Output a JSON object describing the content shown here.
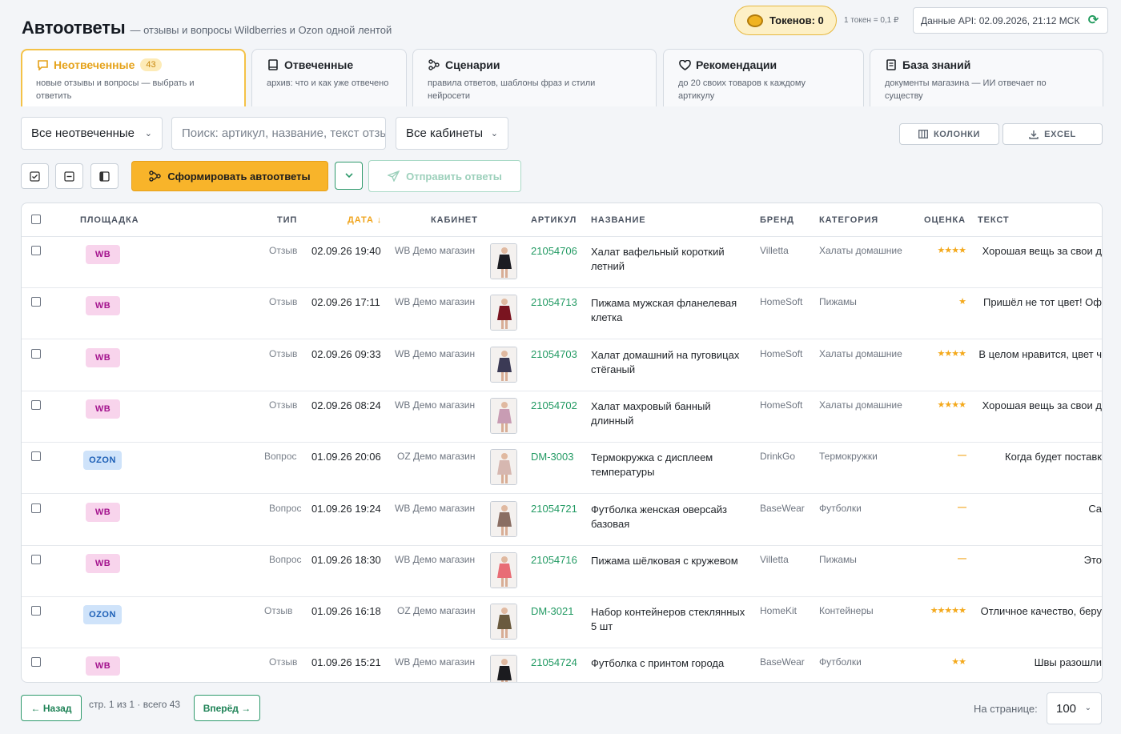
{
  "header": {
    "title": "Автоответы",
    "subtitle": "— отзывы и вопросы Wildberries и Ozon одной лентой",
    "tokens_label": "Токенов: 0",
    "rate": "1 токен = 0,1 ₽",
    "api_status": "Данные API: 02.09.2026, 21:12 МСК"
  },
  "tabs": [
    {
      "label": "Неотвеченные",
      "badge": "43",
      "desc": "новые отзывы и вопросы — выбрать и ответить",
      "icon": "chat-icon",
      "active": true
    },
    {
      "label": "Отвеченные",
      "desc": "архив: что и как уже отвечено",
      "icon": "archive-icon"
    },
    {
      "label": "Сценарии",
      "desc": "правила ответов, шаблоны фраз и стили нейросети",
      "icon": "flow-icon"
    },
    {
      "label": "Рекомендации",
      "desc": "до 20 своих товаров к каждому артикулу",
      "icon": "heart-icon"
    },
    {
      "label": "База знаний",
      "desc": "документы магазина — ИИ отвечает по существу",
      "icon": "book-icon"
    }
  ],
  "filters": {
    "status": "Все неотвеченные",
    "search_placeholder": "Поиск: артикул, название, текст отзыва",
    "cabinet": "Все кабинеты",
    "columns_label": "КОЛОНКИ",
    "excel_label": "EXCEL"
  },
  "actions": {
    "generate_label": "Сформировать автоответы",
    "send_label": "Отправить ответы"
  },
  "table": {
    "headers": {
      "platform": "ПЛОЩАДКА",
      "type": "ТИП",
      "date": "ДАТА ↓",
      "cabinet": "КАБИНЕТ",
      "article": "АРТИКУЛ",
      "name": "НАЗВАНИЕ",
      "brand": "БРЕНД",
      "category": "КАТЕГОРИЯ",
      "rating": "ОЦЕНКА",
      "text": "ТЕКСТ"
    },
    "rows": [
      {
        "platform": "WB",
        "type": "Отзыв",
        "date": "02.09.26 19:40",
        "cabinet": "WB Демо магазин",
        "article": "21054706",
        "name": "Халат вафельный короткий летний",
        "brand": "Villetta",
        "category": "Халаты домашние",
        "rating": "★★★★",
        "text": "Хорошая вещь за свои д"
      },
      {
        "platform": "WB",
        "type": "Отзыв",
        "date": "02.09.26 17:11",
        "cabinet": "WB Демо магазин",
        "article": "21054713",
        "name": "Пижама мужская фланелевая клетка",
        "brand": "HomeSoft",
        "category": "Пижамы",
        "rating": "★",
        "text": "Пришёл не тот цвет! Оф"
      },
      {
        "platform": "WB",
        "type": "Отзыв",
        "date": "02.09.26 09:33",
        "cabinet": "WB Демо магазин",
        "article": "21054703",
        "name": "Халат домашний на пуговицах стёганый",
        "brand": "HomeSoft",
        "category": "Халаты домашние",
        "rating": "★★★★",
        "text": "В целом нравится, цвет ч"
      },
      {
        "platform": "WB",
        "type": "Отзыв",
        "date": "02.09.26 08:24",
        "cabinet": "WB Демо магазин",
        "article": "21054702",
        "name": "Халат махровый банный длинный",
        "brand": "HomeSoft",
        "category": "Халаты домашние",
        "rating": "★★★★",
        "text": "Хорошая вещь за свои д"
      },
      {
        "platform": "OZON",
        "type": "Вопрос",
        "date": "01.09.26 20:06",
        "cabinet": "OZ Демо магазин",
        "article": "DM-3003",
        "name": "Термокружка с дисплеем температуры",
        "brand": "DrinkGo",
        "category": "Термокружки",
        "rating": "—",
        "text": "Когда будет поставк"
      },
      {
        "platform": "WB",
        "type": "Вопрос",
        "date": "01.09.26 19:24",
        "cabinet": "WB Демо магазин",
        "article": "21054721",
        "name": "Футболка женская оверсайз базовая",
        "brand": "BaseWear",
        "category": "Футболки",
        "rating": "—",
        "text": "Ca"
      },
      {
        "platform": "WB",
        "type": "Вопрос",
        "date": "01.09.26 18:30",
        "cabinet": "WB Демо магазин",
        "article": "21054716",
        "name": "Пижама шёлковая с кружевом",
        "brand": "Villetta",
        "category": "Пижамы",
        "rating": "—",
        "text": "Это"
      },
      {
        "platform": "OZON",
        "type": "Отзыв",
        "date": "01.09.26 16:18",
        "cabinet": "OZ Демо магазин",
        "article": "DM-3021",
        "name": "Набор контейнеров стеклянных 5 шт",
        "brand": "HomeKit",
        "category": "Контейнеры",
        "rating": "★★★★★",
        "text": "Отличное качество, беру"
      },
      {
        "platform": "WB",
        "type": "Отзыв",
        "date": "01.09.26 15:21",
        "cabinet": "WB Демо магазин",
        "article": "21054724",
        "name": "Футболка с принтом города",
        "brand": "BaseWear",
        "category": "Футболки",
        "rating": "★★",
        "text": "Швы разошли"
      }
    ]
  },
  "footer": {
    "prev_label": "← Назад",
    "page_info": "стр. 1 из 1 · всего 43",
    "next_label": "Вперёд →",
    "per_page_label": "На странице:",
    "per_page_value": "100"
  }
}
